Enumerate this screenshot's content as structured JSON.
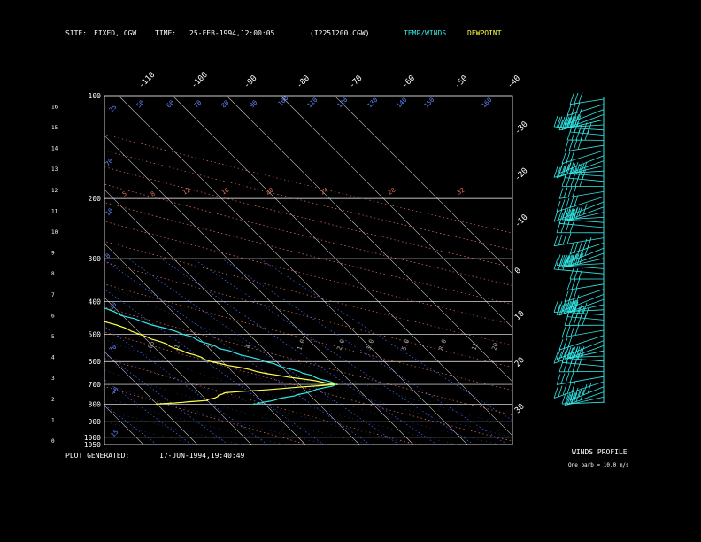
{
  "header": {
    "site_label": "SITE:",
    "site_value": "FIXED, CGW",
    "time_label": "TIME:",
    "time_value": "25-FEB-1994,12:00:05",
    "file_value": "(I2251200.CGW)",
    "legend_temp": "TEMP/WINDS",
    "legend_dew": "DEWPOINT"
  },
  "footer": {
    "generated_label": "PLOT GENERATED:",
    "generated_value": "17-JUN-1994,19:40:49",
    "winds_title": "WINDS PROFILE",
    "winds_note": "One barb = 10.0 m/s"
  },
  "colors": {
    "temp": "#33e6e6",
    "dewpoint": "#ffff44",
    "mixing_ratio": "#4466ff",
    "dry_adiabat": "#e07060",
    "grid": "#ffffff"
  },
  "chart_data": {
    "type": "line",
    "title": "",
    "pressure_levels": [
      100,
      200,
      300,
      400,
      500,
      600,
      700,
      800,
      900,
      1000,
      1050
    ],
    "height_ticks": [
      0,
      1,
      2,
      3,
      4,
      5,
      6,
      7,
      8,
      9,
      10,
      11,
      12,
      13,
      14,
      15,
      16
    ],
    "top_isotherm_labels": [
      "-110",
      "-100",
      "-90",
      "-80",
      "-70",
      "-60",
      "-50",
      "-40"
    ],
    "right_isotherm_labels": [
      "-30",
      "-20",
      "-10",
      "0",
      "10",
      "20",
      "30"
    ],
    "mixing_ratio_labels": [
      ".05",
      ".1",
      ".2",
      ".4",
      "1.0",
      "2.0",
      "3.0",
      "5.0",
      "8.0",
      "12",
      "20"
    ],
    "theta_labels": [
      "25",
      "50",
      "60",
      "70",
      "80",
      "90",
      "100",
      "110",
      "120",
      "130",
      "140",
      "150",
      "160"
    ],
    "red_theta_labels": [
      "5",
      "8",
      "12",
      "16",
      "20",
      "24",
      "28",
      "32"
    ],
    "series": [
      {
        "name": "TEMP/WINDS",
        "points": [
          [
            150,
            -39
          ],
          [
            175,
            -44
          ],
          [
            190,
            -52
          ],
          [
            205,
            -54
          ],
          [
            215,
            -55
          ],
          [
            240,
            -52
          ],
          [
            280,
            -48
          ],
          [
            330,
            -42
          ],
          [
            380,
            -36
          ],
          [
            440,
            -30
          ],
          [
            500,
            -22
          ],
          [
            550,
            -18
          ],
          [
            600,
            -12
          ],
          [
            650,
            -7
          ],
          [
            700,
            -3
          ],
          [
            750,
            -12
          ],
          [
            790,
            -20
          ],
          [
            800,
            -22
          ]
        ]
      },
      {
        "name": "DEWPOINT",
        "points": [
          [
            150,
            -50
          ],
          [
            175,
            -54
          ],
          [
            200,
            -58
          ],
          [
            230,
            -60
          ],
          [
            270,
            -56
          ],
          [
            320,
            -50
          ],
          [
            380,
            -43
          ],
          [
            440,
            -36
          ],
          [
            500,
            -30
          ],
          [
            550,
            -26
          ],
          [
            600,
            -22
          ],
          [
            650,
            -14
          ],
          [
            700,
            -3
          ],
          [
            740,
            -25
          ],
          [
            780,
            -30
          ],
          [
            800,
            -40
          ]
        ]
      }
    ],
    "winds_profile": {
      "pressures": [
        125,
        175,
        225,
        275,
        325,
        375,
        425,
        475,
        525,
        575,
        625,
        675
      ],
      "barbs": [
        3,
        3,
        4,
        4,
        5,
        5,
        4,
        5,
        5,
        4,
        3,
        3
      ]
    }
  }
}
